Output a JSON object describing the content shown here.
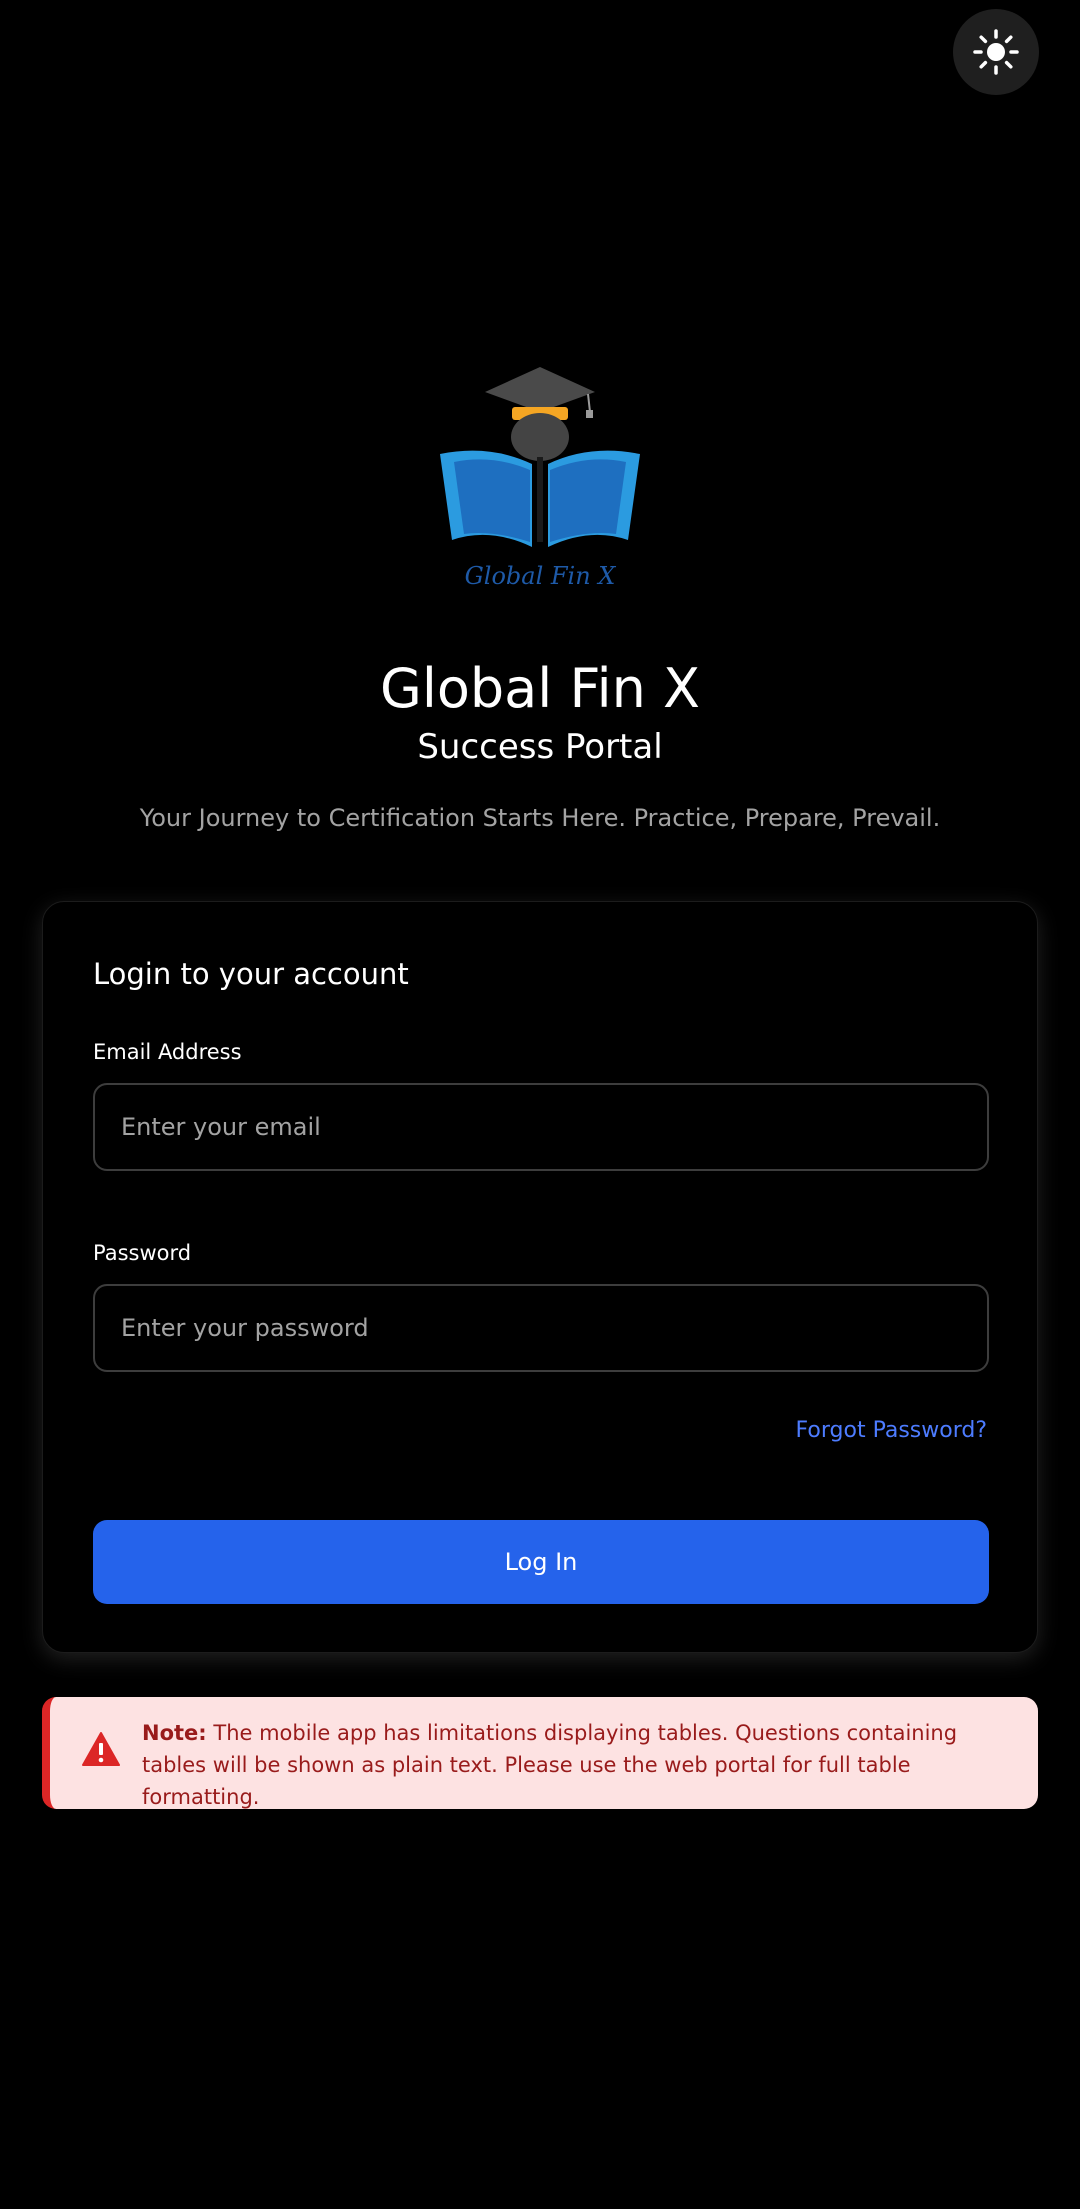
{
  "header": {
    "theme_toggle_icon": "sun-icon"
  },
  "branding": {
    "logo_icon": "graduation-book-logo",
    "logo_text": "Global Fin X",
    "title": "Global Fin X",
    "subtitle": "Success Portal",
    "tagline": "Your Journey to Certification Starts Here. Practice, Prepare, Prevail."
  },
  "login": {
    "heading": "Login to your account",
    "email_label": "Email Address",
    "email_placeholder": "Enter your email",
    "email_value": "",
    "password_label": "Password",
    "password_placeholder": "Enter your password",
    "password_value": "",
    "forgot_password": "Forgot Password?",
    "submit_label": "Log In"
  },
  "note": {
    "icon": "warning-icon",
    "label": "Note:",
    "text": " The mobile app has limitations displaying tables. Questions containing tables will be shown as plain text. Please use the web portal for full table formatting."
  },
  "colors": {
    "background": "#000000",
    "accent": "#2563eb",
    "link": "#4d7cff",
    "note_background": "#fde2e2",
    "note_border": "#dc2626",
    "note_text": "#991b1b",
    "logo_blue": "#2b9be0",
    "logo_dark_blue": "#1e5aa8",
    "logo_cap_band": "#f5a623"
  }
}
